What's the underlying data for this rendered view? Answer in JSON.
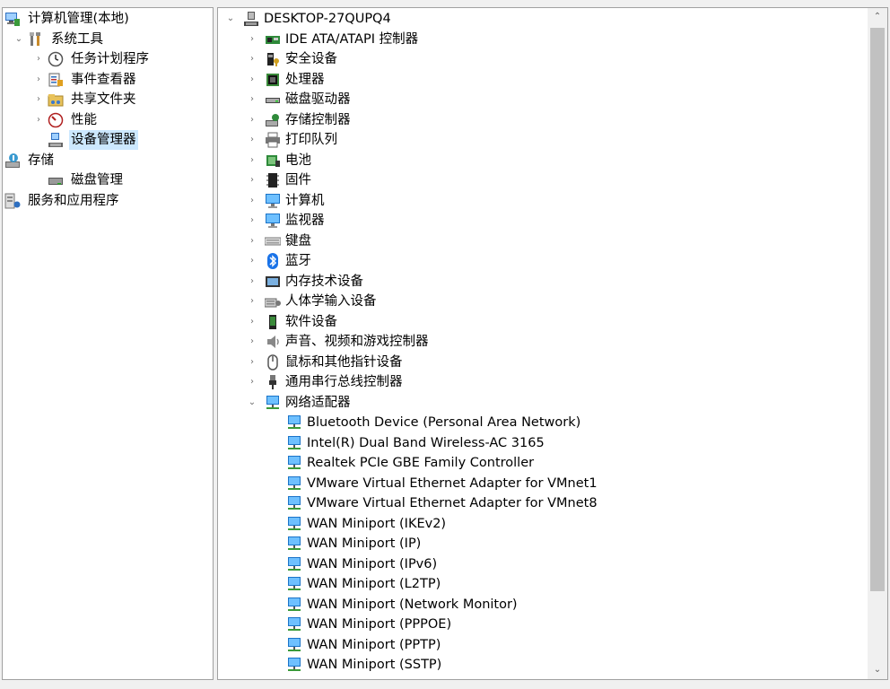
{
  "left_tree": [
    {
      "label": "计算机管理(本地)",
      "icon": "computer-manage-icon",
      "depth": 0,
      "twisty": ""
    },
    {
      "label": "系统工具",
      "icon": "tools-icon",
      "depth": 1,
      "twisty": "⌄"
    },
    {
      "label": "任务计划程序",
      "icon": "clock-icon",
      "depth": 2,
      "twisty": "›"
    },
    {
      "label": "事件查看器",
      "icon": "event-viewer-icon",
      "depth": 2,
      "twisty": "›"
    },
    {
      "label": "共享文件夹",
      "icon": "shared-folder-icon",
      "depth": 2,
      "twisty": "›"
    },
    {
      "label": "性能",
      "icon": "performance-icon",
      "depth": 2,
      "twisty": "›"
    },
    {
      "label": "设备管理器",
      "icon": "device-manager-icon",
      "depth": 2,
      "twisty": "",
      "selected": true
    },
    {
      "label": "存储",
      "icon": "storage-icon",
      "depth": 0,
      "twisty": "⌄"
    },
    {
      "label": "磁盘管理",
      "icon": "disk-icon",
      "depth": 2,
      "twisty": ""
    },
    {
      "label": "服务和应用程序",
      "icon": "services-icon",
      "depth": 0,
      "twisty": "›"
    }
  ],
  "right_tree": [
    {
      "label": "DESKTOP-27QUPQ4",
      "icon": "computer-root-icon",
      "depth": 0,
      "twisty": "⌄"
    },
    {
      "label": "IDE ATA/ATAPI 控制器",
      "icon": "ide-controller-icon",
      "depth": 1,
      "twisty": "›"
    },
    {
      "label": "安全设备",
      "icon": "security-device-icon",
      "depth": 1,
      "twisty": "›"
    },
    {
      "label": "处理器",
      "icon": "processor-icon",
      "depth": 1,
      "twisty": "›"
    },
    {
      "label": "磁盘驱动器",
      "icon": "disk-drive-icon",
      "depth": 1,
      "twisty": "›"
    },
    {
      "label": "存储控制器",
      "icon": "storage-controller-icon",
      "depth": 1,
      "twisty": "›"
    },
    {
      "label": "打印队列",
      "icon": "printer-icon",
      "depth": 1,
      "twisty": "›"
    },
    {
      "label": "电池",
      "icon": "battery-icon",
      "depth": 1,
      "twisty": "›"
    },
    {
      "label": "固件",
      "icon": "firmware-icon",
      "depth": 1,
      "twisty": "›"
    },
    {
      "label": "计算机",
      "icon": "computer-icon",
      "depth": 1,
      "twisty": "›"
    },
    {
      "label": "监视器",
      "icon": "monitor-icon",
      "depth": 1,
      "twisty": "›"
    },
    {
      "label": "键盘",
      "icon": "keyboard-icon",
      "depth": 1,
      "twisty": "›"
    },
    {
      "label": "蓝牙",
      "icon": "bluetooth-icon",
      "depth": 1,
      "twisty": "›"
    },
    {
      "label": "内存技术设备",
      "icon": "memory-device-icon",
      "depth": 1,
      "twisty": "›"
    },
    {
      "label": "人体学输入设备",
      "icon": "hid-icon",
      "depth": 1,
      "twisty": "›"
    },
    {
      "label": "软件设备",
      "icon": "software-device-icon",
      "depth": 1,
      "twisty": "›"
    },
    {
      "label": "声音、视频和游戏控制器",
      "icon": "speaker-icon",
      "depth": 1,
      "twisty": "›"
    },
    {
      "label": "鼠标和其他指针设备",
      "icon": "mouse-icon",
      "depth": 1,
      "twisty": "›"
    },
    {
      "label": "通用串行总线控制器",
      "icon": "usb-icon",
      "depth": 1,
      "twisty": "›"
    },
    {
      "label": "网络适配器",
      "icon": "network-adapter-icon",
      "depth": 1,
      "twisty": "⌄"
    },
    {
      "label": "Bluetooth Device (Personal Area Network)",
      "icon": "network-adapter-icon",
      "depth": 2,
      "twisty": ""
    },
    {
      "label": "Intel(R) Dual Band Wireless-AC 3165",
      "icon": "network-adapter-icon",
      "depth": 2,
      "twisty": ""
    },
    {
      "label": "Realtek PCIe GBE Family Controller",
      "icon": "network-adapter-icon",
      "depth": 2,
      "twisty": ""
    },
    {
      "label": "VMware Virtual Ethernet Adapter for VMnet1",
      "icon": "network-adapter-icon",
      "depth": 2,
      "twisty": ""
    },
    {
      "label": "VMware Virtual Ethernet Adapter for VMnet8",
      "icon": "network-adapter-icon",
      "depth": 2,
      "twisty": ""
    },
    {
      "label": "WAN Miniport (IKEv2)",
      "icon": "network-adapter-icon",
      "depth": 2,
      "twisty": ""
    },
    {
      "label": "WAN Miniport (IP)",
      "icon": "network-adapter-icon",
      "depth": 2,
      "twisty": ""
    },
    {
      "label": "WAN Miniport (IPv6)",
      "icon": "network-adapter-icon",
      "depth": 2,
      "twisty": ""
    },
    {
      "label": "WAN Miniport (L2TP)",
      "icon": "network-adapter-icon",
      "depth": 2,
      "twisty": ""
    },
    {
      "label": "WAN Miniport (Network Monitor)",
      "icon": "network-adapter-icon",
      "depth": 2,
      "twisty": ""
    },
    {
      "label": "WAN Miniport (PPPOE)",
      "icon": "network-adapter-icon",
      "depth": 2,
      "twisty": ""
    },
    {
      "label": "WAN Miniport (PPTP)",
      "icon": "network-adapter-icon",
      "depth": 2,
      "twisty": ""
    },
    {
      "label": "WAN Miniport (SSTP)",
      "icon": "network-adapter-icon",
      "depth": 2,
      "twisty": ""
    }
  ],
  "scroll": {
    "up": "⌃",
    "down": "⌄"
  },
  "colors": {
    "selection": "#cce8ff",
    "accent": "#1a73c8"
  }
}
